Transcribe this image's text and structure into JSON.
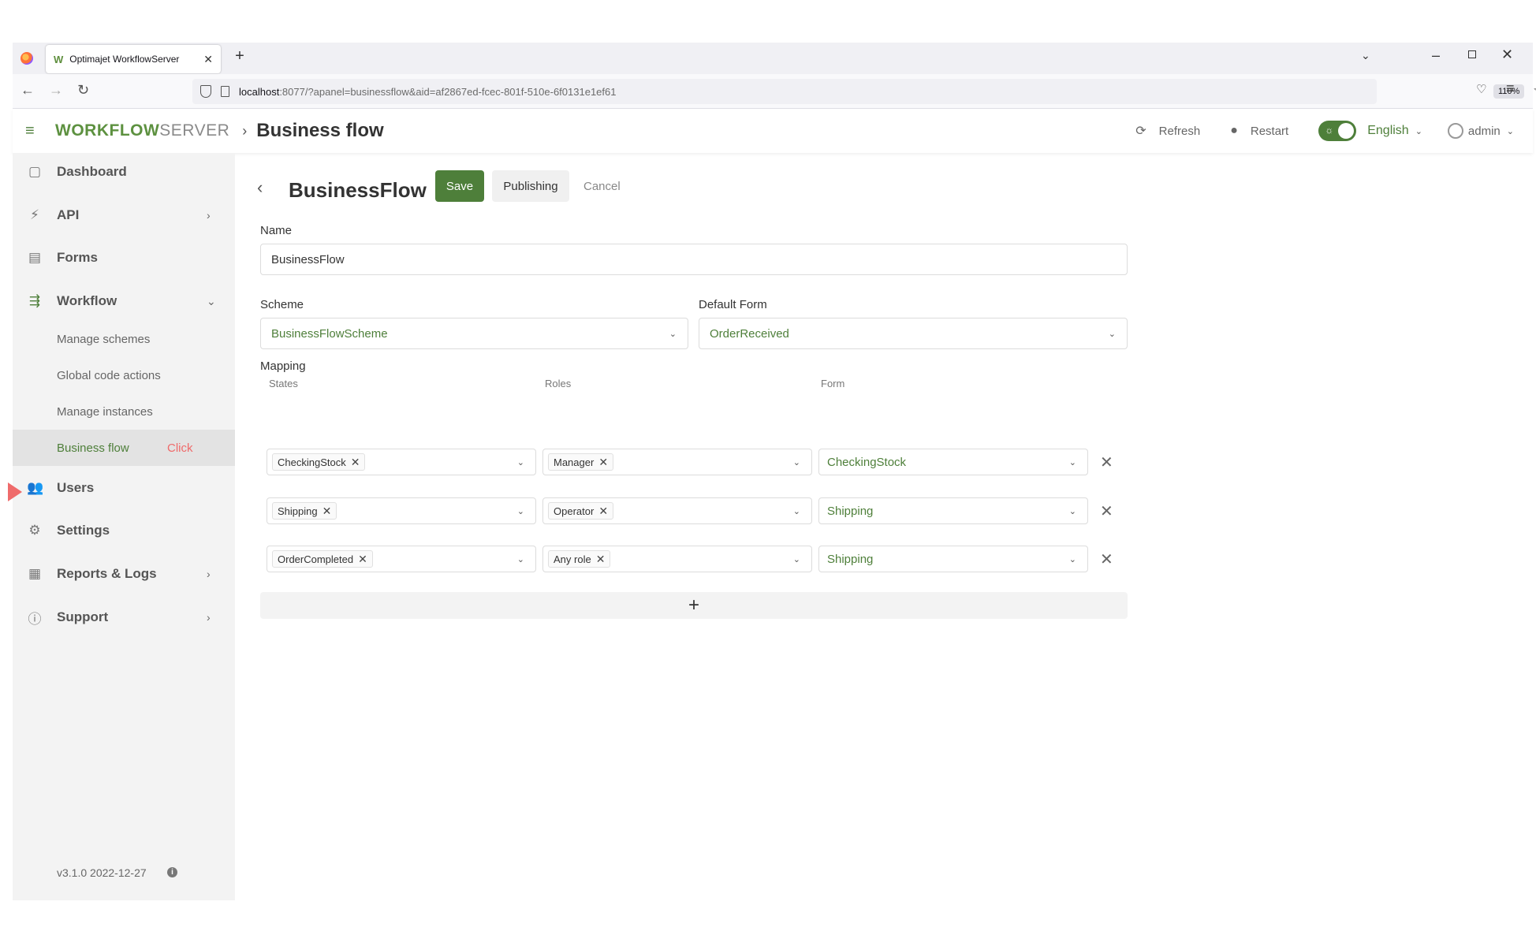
{
  "browser": {
    "tab_title": "Optimajet WorkflowServer",
    "tab_favicon": "W",
    "url_host": "localhost",
    "url_rest": ":8077/?apanel=businessflow&aid=af2867ed-fcec-801f-510e-6f0131e1ef61",
    "zoom": "110%"
  },
  "header": {
    "logo_bold": "WORKFLOW",
    "logo_light": "SERVER",
    "breadcrumb": "Business flow",
    "refresh_label": "Refresh",
    "restart_label": "Restart",
    "language": "English",
    "user": "admin",
    "accent_color": "#4e7f3a"
  },
  "sidebar": {
    "items": [
      {
        "label": "Dashboard",
        "icon": "dashboard-icon"
      },
      {
        "label": "API",
        "icon": "plug-icon"
      },
      {
        "label": "Forms",
        "icon": "forms-icon"
      },
      {
        "label": "Workflow",
        "icon": "workflow-icon"
      },
      {
        "label": "Users",
        "icon": "users-icon"
      },
      {
        "label": "Settings",
        "icon": "settings-icon"
      },
      {
        "label": "Reports & Logs",
        "icon": "reports-icon"
      },
      {
        "label": "Support",
        "icon": "support-icon"
      }
    ],
    "workflow_sub": [
      "Manage schemes",
      "Global code actions",
      "Manage instances",
      "Business flow"
    ],
    "click_tip": "Click",
    "version": "v3.1.0 2022-12-27"
  },
  "form": {
    "title": "BusinessFlow",
    "save_label": "Save",
    "publishing_label": "Publishing",
    "cancel_label": "Cancel",
    "name_label": "Name",
    "name_value": "BusinessFlow",
    "scheme_label": "Scheme",
    "scheme_value": "BusinessFlowScheme",
    "default_form_label": "Default Form",
    "default_form_value": "OrderReceived",
    "mapping_label": "Mapping",
    "columns": [
      "States",
      "Roles",
      "Form"
    ],
    "rows": [
      {
        "state": "CheckingStock",
        "role": "Manager",
        "form": "CheckingStock"
      },
      {
        "state": "Shipping",
        "role": "Operator",
        "form": "Shipping"
      },
      {
        "state": "OrderCompleted",
        "role": "Any role",
        "form": "Shipping"
      }
    ],
    "add_label": "+"
  }
}
